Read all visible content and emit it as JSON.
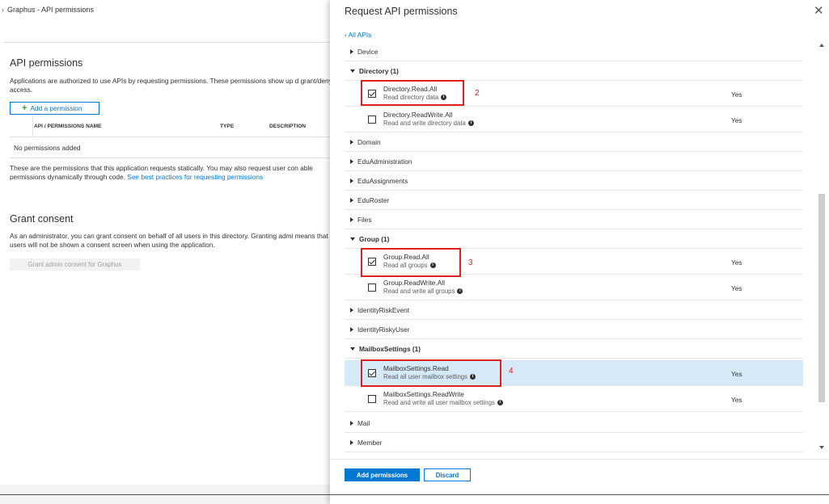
{
  "breadcrumb": {
    "text": "Graphus - API permissions"
  },
  "left": {
    "api_title": "API permissions",
    "api_desc": "Applications are authorized to use APIs by requesting permissions. These permissions show up d grant/deny access.",
    "add_permission_label": "Add a permission",
    "table_headers": {
      "name": "API / PERMISSIONS NAME",
      "type": "TYPE",
      "description": "DESCRIPTION"
    },
    "empty_text": "No permissions added",
    "static_text": "These are the permissions that this application requests statically. You may also request user con able permissions dynamically through code.",
    "best_practices_link": "See best practices for requesting permissions",
    "grant_title": "Grant consent",
    "grant_desc": "As an administrator, you can grant consent on behalf of all users in this directory. Granting admi means that end users will not be shown a consent screen when using the application.",
    "grant_button": "Grant admin consent for Graphus"
  },
  "panel": {
    "title": "Request API permissions",
    "back_link": "‹ All APIs",
    "groups": {
      "device": "Device",
      "directory": "Directory (1)",
      "domain": "Domain",
      "eduadministration": "EduAdministration",
      "eduassignments": "EduAssignments",
      "eduroster": "EduRoster",
      "files": "Files",
      "group": "Group (1)",
      "identityriskevent": "IdentityRiskEvent",
      "identityriskyuser": "IdentityRiskyUser",
      "mailboxsettings": "MailboxSettings (1)",
      "mail": "Mail",
      "member": "Member"
    },
    "permissions": {
      "dir_read": {
        "name": "Directory.Read.All",
        "desc": "Read directory data",
        "admin": "Yes",
        "checked": true
      },
      "dir_rw": {
        "name": "Directory.ReadWrite.All",
        "desc": "Read and write directory data",
        "admin": "Yes",
        "checked": false
      },
      "grp_read": {
        "name": "Group.Read.All",
        "desc": "Read all groups",
        "admin": "Yes",
        "checked": true
      },
      "grp_rw": {
        "name": "Group.ReadWrite.All",
        "desc": "Read and write all groups",
        "admin": "Yes",
        "checked": false
      },
      "mbx_read": {
        "name": "MailboxSettings.Read",
        "desc": "Read all user mailbox settings",
        "admin": "Yes",
        "checked": true
      },
      "mbx_rw": {
        "name": "MailboxSettings.ReadWrite",
        "desc": "Read and write all user mailbox settings",
        "admin": "Yes",
        "checked": false
      }
    },
    "annotations": {
      "a2": "2",
      "a3": "3",
      "a4": "4"
    },
    "add_button": "Add permissions",
    "discard_button": "Discard",
    "colors": {
      "accent": "#0078d4",
      "annotation": "#e02020",
      "highlight": "#d6e9f7"
    }
  }
}
